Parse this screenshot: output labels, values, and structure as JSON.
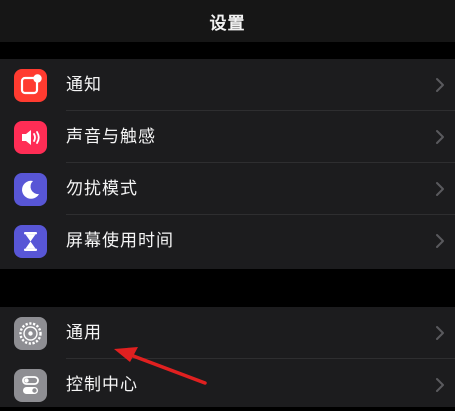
{
  "nav": {
    "title": "设置"
  },
  "group1": [
    {
      "label": "通知",
      "icon": "notifications-icon",
      "color": "#ff3b30"
    },
    {
      "label": "声音与触感",
      "icon": "speaker-icon",
      "color": "#ff2d55"
    },
    {
      "label": "勿扰模式",
      "icon": "moon-icon",
      "color": "#5856d6"
    },
    {
      "label": "屏幕使用时间",
      "icon": "hourglass-icon",
      "color": "#5856d6"
    }
  ],
  "group2": [
    {
      "label": "通用",
      "icon": "gear-icon",
      "color": "#8e8e93"
    },
    {
      "label": "控制中心",
      "icon": "toggles-icon",
      "color": "#8e8e93"
    }
  ],
  "annotation": {
    "color": "#e02020"
  }
}
